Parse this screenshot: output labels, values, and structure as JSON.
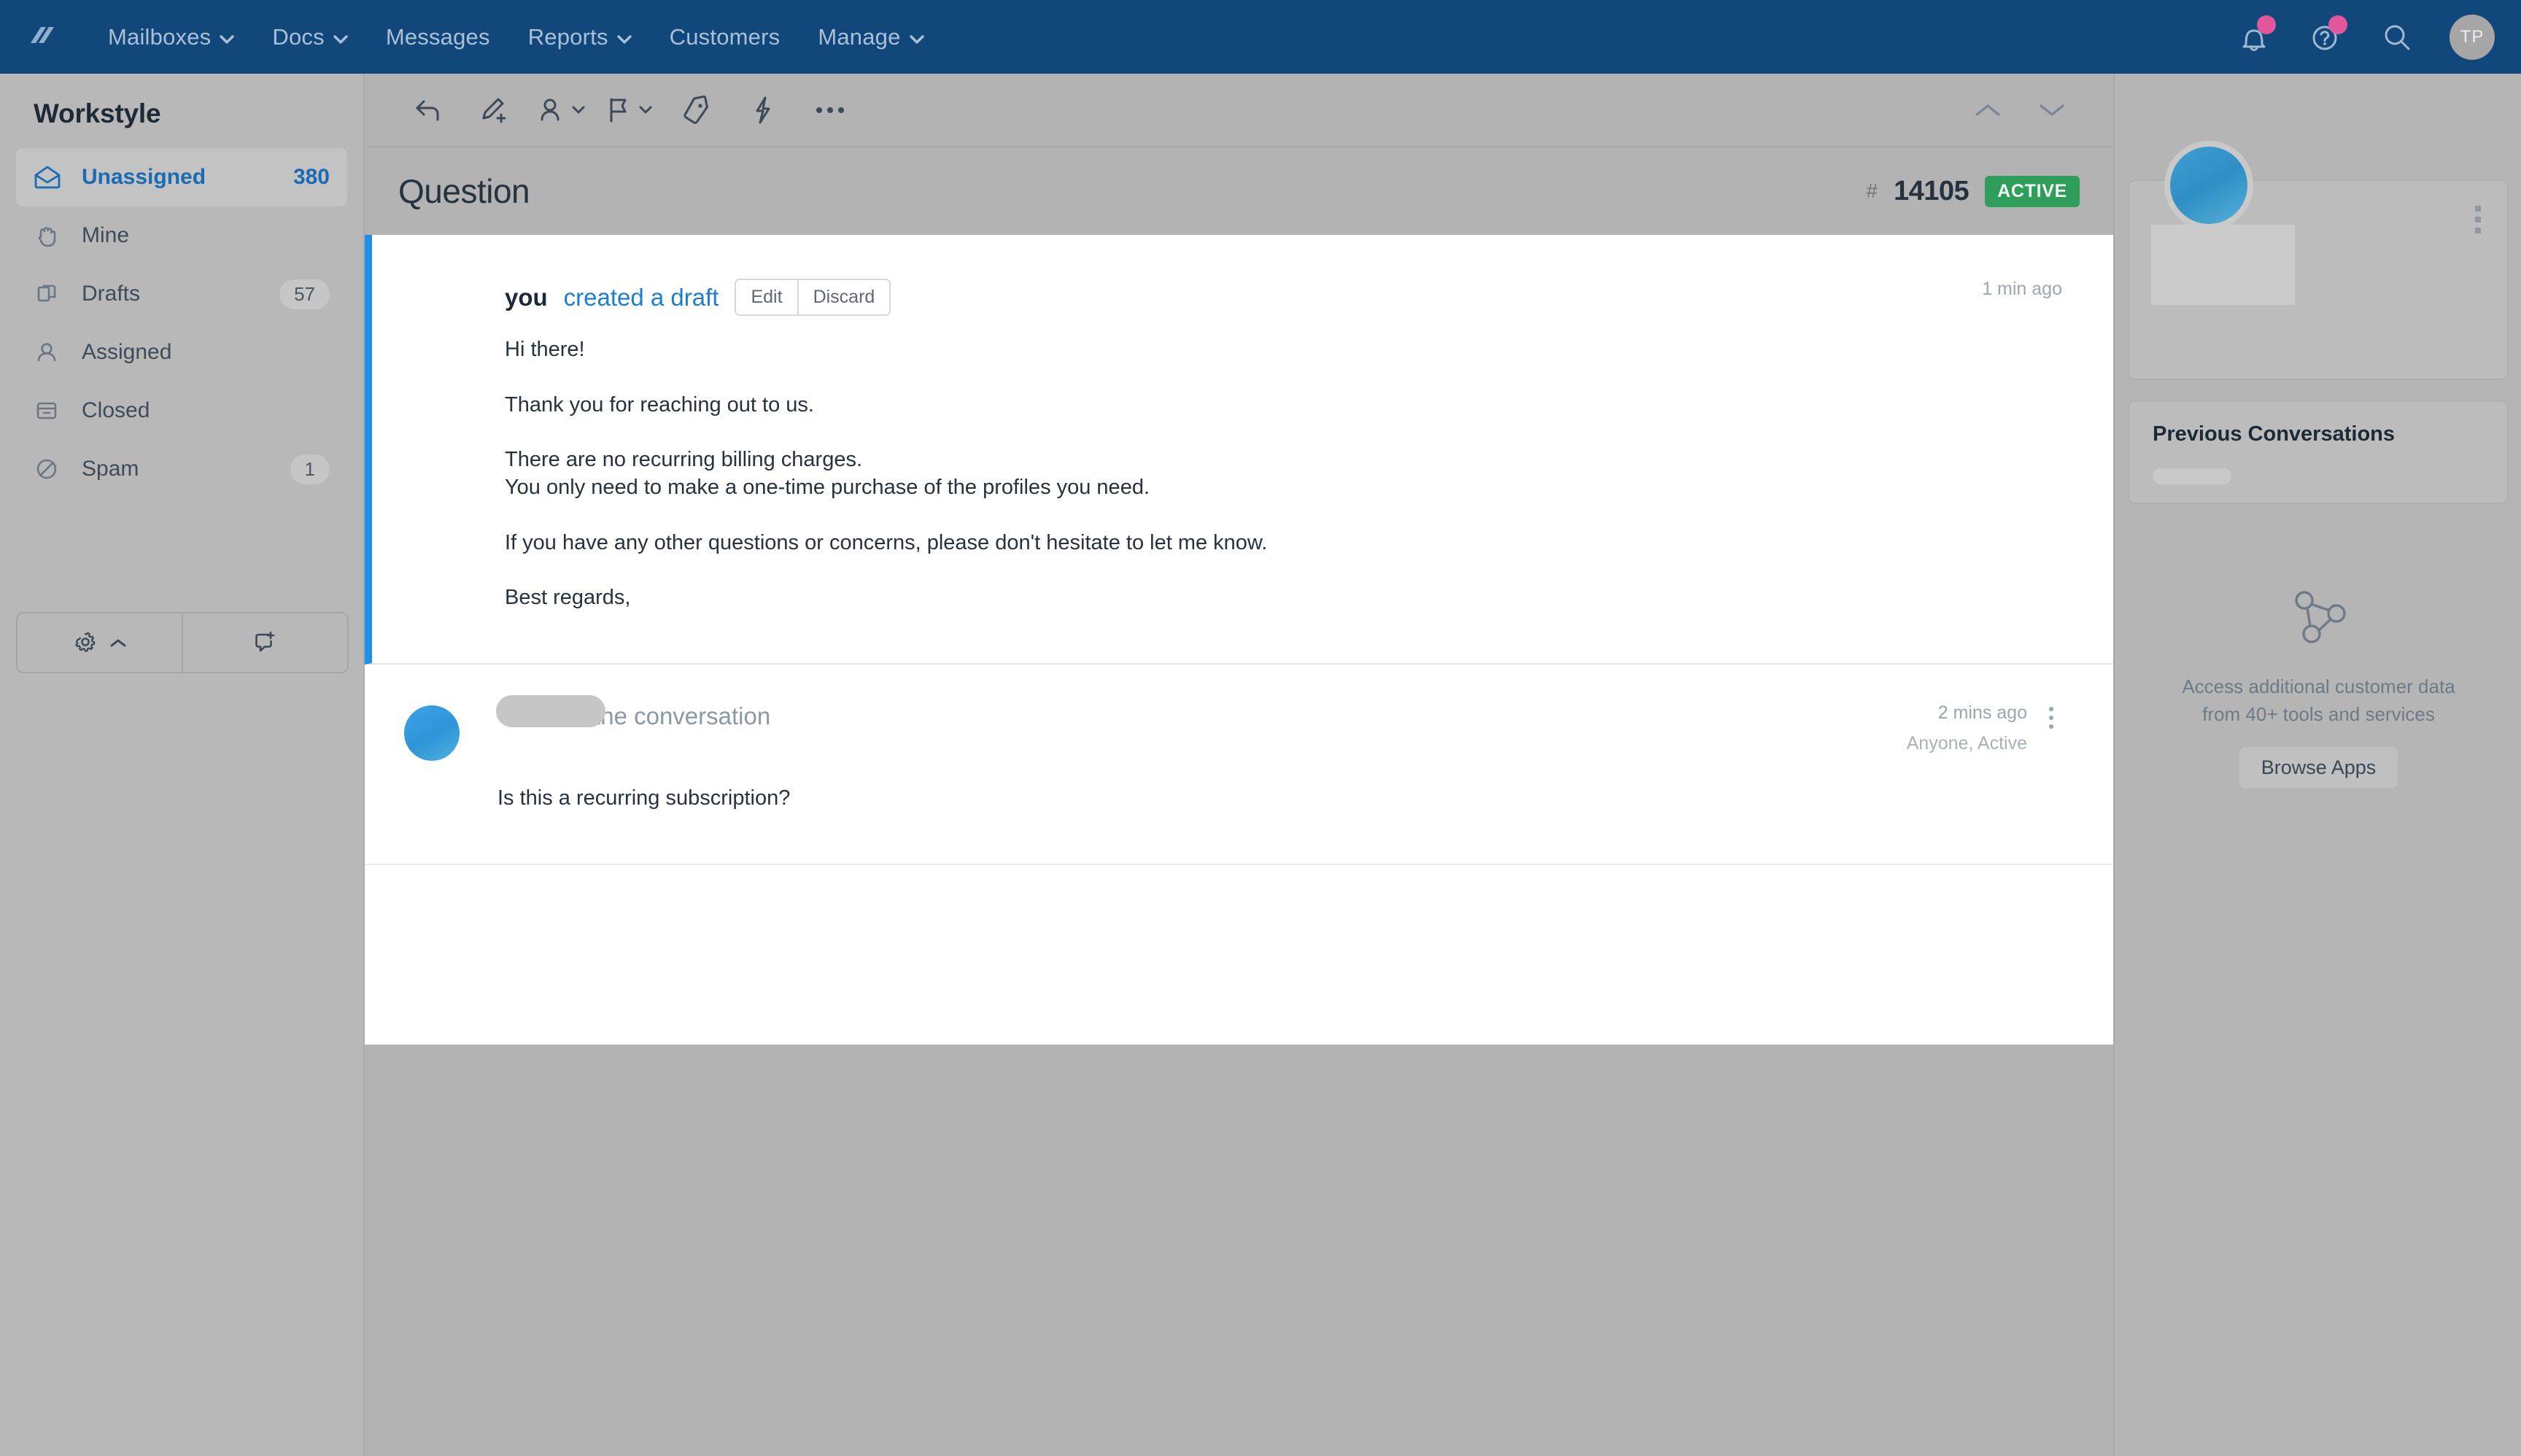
{
  "topnav": {
    "logo": "helpscout-logo-icon",
    "items": [
      {
        "label": "Mailboxes",
        "caret": true
      },
      {
        "label": "Docs",
        "caret": true
      },
      {
        "label": "Messages",
        "caret": false
      },
      {
        "label": "Reports",
        "caret": true
      },
      {
        "label": "Customers",
        "caret": false
      },
      {
        "label": "Manage",
        "caret": true
      }
    ],
    "right": {
      "notifications_icon": "bell-icon",
      "help_icon": "help-circle-icon",
      "search_icon": "search-icon",
      "avatar_initials": "TP",
      "badge_color": "#e0589b"
    }
  },
  "sidebar": {
    "mailbox_name": "Workstyle",
    "folders": [
      {
        "label": "Unassigned",
        "count": "380",
        "icon": "open-envelope-icon",
        "active": true
      },
      {
        "label": "Mine",
        "count": "",
        "icon": "hand-icon",
        "active": false
      },
      {
        "label": "Drafts",
        "count": "57",
        "icon": "drafts-icon",
        "active": false
      },
      {
        "label": "Assigned",
        "count": "",
        "icon": "person-icon",
        "active": false
      },
      {
        "label": "Closed",
        "count": "",
        "icon": "archive-icon",
        "active": false
      },
      {
        "label": "Spam",
        "count": "1",
        "icon": "no-entry-icon",
        "active": false
      }
    ],
    "footer": {
      "settings_icon": "gear-icon",
      "settings_caret_icon": "chevron-up-icon",
      "new_conversation_icon": "new-conversation-icon"
    },
    "active_color": "#1a6bb4"
  },
  "toolbar": {
    "buttons": [
      {
        "name": "reply",
        "icon": "reply-arrow-icon",
        "caret": false
      },
      {
        "name": "note",
        "icon": "pencil-plus-icon",
        "caret": false
      },
      {
        "name": "assign",
        "icon": "person-icon",
        "caret": true
      },
      {
        "name": "status",
        "icon": "flag-icon",
        "caret": true
      },
      {
        "name": "tag",
        "icon": "tag-icon",
        "caret": false
      },
      {
        "name": "workflow",
        "icon": "lightning-icon",
        "caret": false
      },
      {
        "name": "more",
        "icon": "ellipsis-icon",
        "caret": false
      }
    ],
    "prev_icon": "chevron-up-icon",
    "next_icon": "chevron-down-icon"
  },
  "conversation": {
    "title": "Question",
    "hash_symbol": "#",
    "number": "14105",
    "status": "ACTIVE",
    "status_color": "#2f9e5a",
    "accent_color": "#1e90e8"
  },
  "thread": [
    {
      "type": "draft",
      "author": "you",
      "action_link": "created a draft",
      "edit_label": "Edit",
      "discard_label": "Discard",
      "time": "1 min ago",
      "body": [
        "Hi there!",
        "",
        "Thank you for reaching out to us.",
        "",
        "There are no recurring billing charges.",
        "You only need to make a one-time purchase of the profiles you need.",
        "",
        "If you have any other questions or concerns, please don't hesitate to let me know.",
        "",
        "Best regards,"
      ]
    },
    {
      "type": "message",
      "author_redacted": true,
      "action_text": "started the conversation",
      "time": "2 mins ago",
      "assignment": "Anyone, Active",
      "body": [
        "Is this a recurring subscription?"
      ]
    }
  ],
  "rightbar": {
    "customer_card": {
      "avatar": "customer-avatar",
      "details_redacted": true,
      "more_icon": "kebab-menu-icon"
    },
    "previous_conversations": {
      "title": "Previous Conversations",
      "item_redacted": true
    },
    "apps": {
      "icon": "network-nodes-icon",
      "text_line1": "Access additional customer data",
      "text_line2": "from 40+ tools and services",
      "button_label": "Browse Apps"
    }
  }
}
